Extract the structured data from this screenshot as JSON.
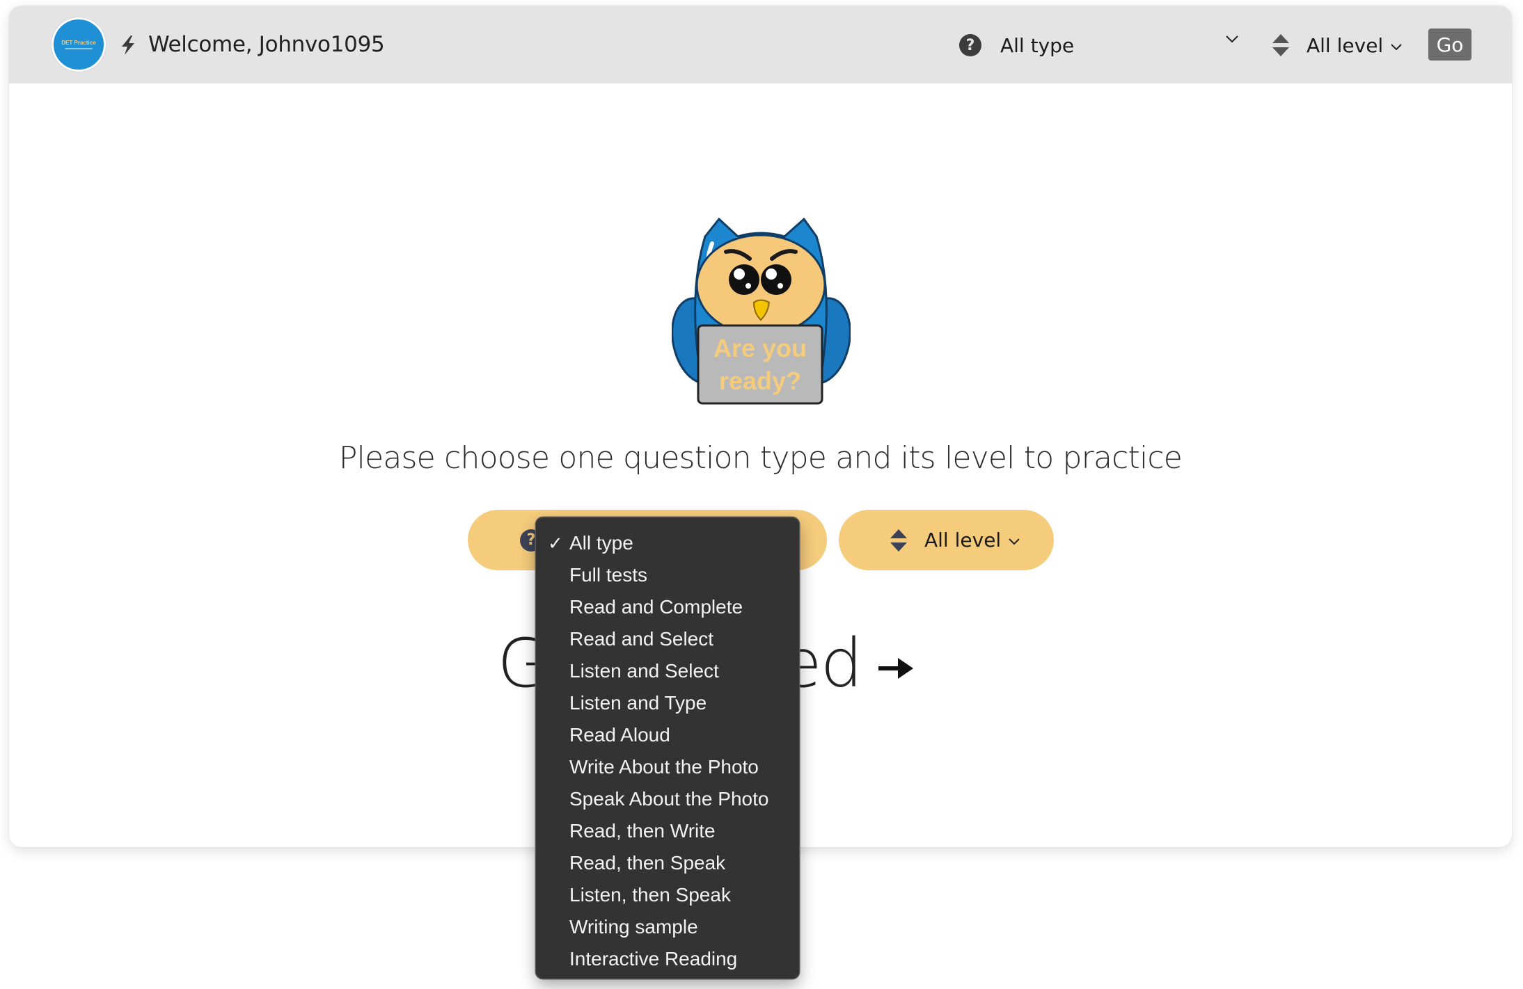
{
  "header": {
    "logo_text": "DET Practice",
    "welcome": "Welcome, Johnvo1095",
    "type_select": {
      "icon": "question-circle-icon",
      "value": "All type"
    },
    "level_select": {
      "icon": "sort-icon",
      "value": "All level"
    },
    "go_label": "Go"
  },
  "main": {
    "illustration": {
      "name": "owl-mascot",
      "caption_line1": "Are you",
      "caption_line2": "ready?"
    },
    "headline": "Please choose one question type and its level to practice",
    "type_select": {
      "icon": "question-circle-icon",
      "value": "All type"
    },
    "level_select": {
      "icon": "sort-icon",
      "value": "All level"
    },
    "get_started": {
      "label": "Get started",
      "icon": "arrow-right-icon"
    }
  },
  "dropdown": {
    "selected": "All type",
    "check_glyph": "✓",
    "options": [
      "All type",
      "Full tests",
      "Read and Complete",
      "Read and Select",
      "Listen and Select",
      "Listen and Type",
      "Read Aloud",
      "Write About the Photo",
      "Speak About the Photo",
      "Read, then Write",
      "Read, then Speak",
      "Listen, then Speak",
      "Writing sample",
      "Interactive Reading"
    ]
  },
  "colors": {
    "header_bg": "#e4e4e4",
    "accent_pill": "#f5cb7c",
    "go_button": "#6d6d6d",
    "dropdown_bg": "#333333",
    "logo_blue": "#1f8fd6",
    "owl_blue": "#1c86cf"
  }
}
